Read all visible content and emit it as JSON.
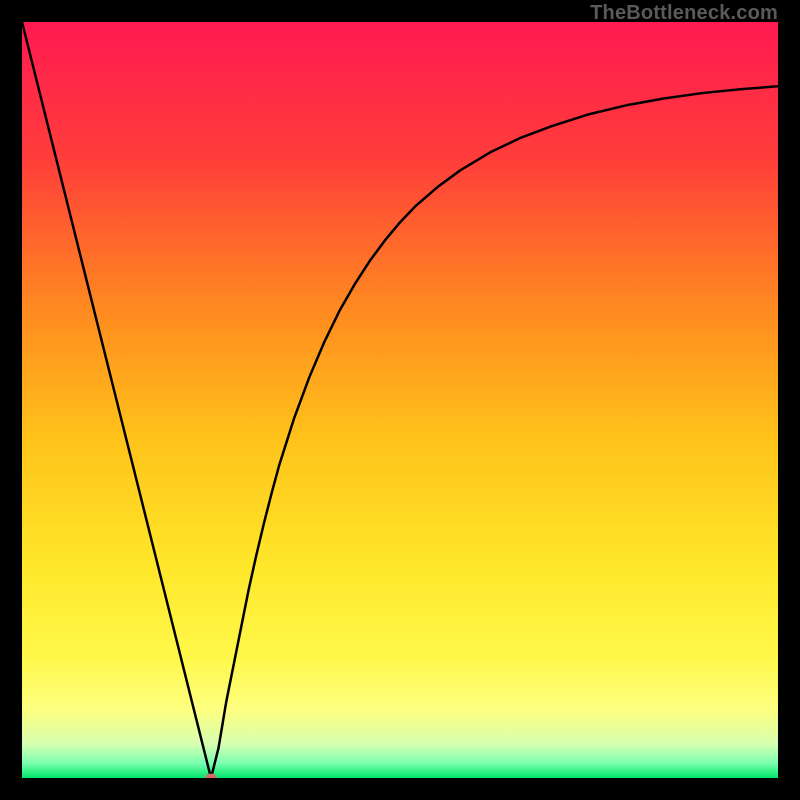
{
  "attribution": "TheBottleneck.com",
  "chart_data": {
    "type": "line",
    "title": "",
    "xlabel": "",
    "ylabel": "",
    "xlim": [
      0,
      100
    ],
    "ylim": [
      0,
      100
    ],
    "legend": false,
    "grid": false,
    "background_gradient_stops": [
      {
        "offset": 0.0,
        "color": "#ff1a51"
      },
      {
        "offset": 0.18,
        "color": "#ff3d3a"
      },
      {
        "offset": 0.38,
        "color": "#ff8a20"
      },
      {
        "offset": 0.55,
        "color": "#ffc21a"
      },
      {
        "offset": 0.72,
        "color": "#ffe72a"
      },
      {
        "offset": 0.84,
        "color": "#fff84a"
      },
      {
        "offset": 0.91,
        "color": "#fdff80"
      },
      {
        "offset": 0.955,
        "color": "#d6ffb0"
      },
      {
        "offset": 0.98,
        "color": "#7dffb0"
      },
      {
        "offset": 1.0,
        "color": "#00e66a"
      }
    ],
    "series": [
      {
        "name": "curve",
        "color": "#000000",
        "width": 2.5,
        "x": [
          0,
          2,
          4,
          6,
          8,
          10,
          12,
          14,
          16,
          18,
          20,
          22,
          24,
          25,
          26,
          27,
          28,
          29,
          30,
          31,
          32,
          33,
          34,
          36,
          38,
          40,
          42,
          44,
          46,
          48,
          50,
          52,
          55,
          58,
          62,
          66,
          70,
          75,
          80,
          85,
          90,
          95,
          100
        ],
        "y": [
          100,
          92,
          84,
          76,
          68,
          60,
          52,
          44,
          36,
          28,
          20,
          12,
          4,
          0,
          4,
          10,
          15,
          20,
          25,
          29.5,
          33.7,
          37.6,
          41.3,
          47.6,
          53.0,
          57.7,
          61.8,
          65.3,
          68.4,
          71.1,
          73.5,
          75.6,
          78.2,
          80.4,
          82.8,
          84.7,
          86.2,
          87.8,
          89.0,
          89.9,
          90.6,
          91.1,
          91.5
        ]
      }
    ],
    "marker": {
      "x": 25,
      "y": 0,
      "color": "#d26b6b",
      "rx": 6,
      "ry": 4.5
    }
  }
}
